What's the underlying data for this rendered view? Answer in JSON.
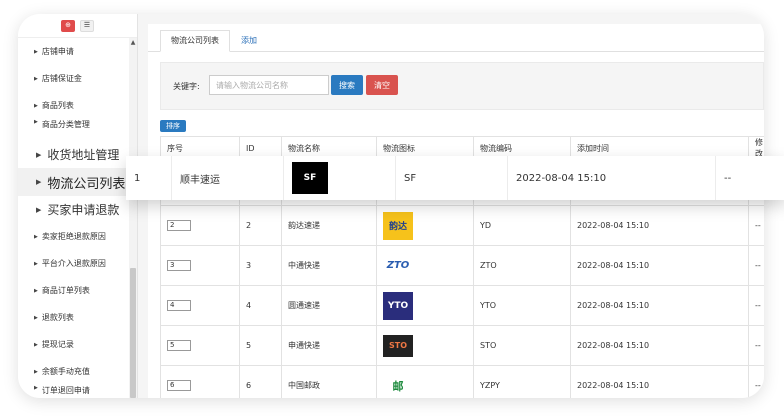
{
  "sidebar": {
    "top_buttons": [
      {
        "glyph": "⊕",
        "color": "#e04b4b"
      },
      {
        "glyph": "☰"
      }
    ],
    "items": [
      {
        "label": "店铺申请",
        "style": "normal"
      },
      {
        "label": "店铺保证金",
        "style": "normal"
      },
      {
        "label": "商品列表",
        "style": "normal"
      },
      {
        "label": "商品分类管理",
        "style": "partial"
      },
      {
        "label": "收货地址管理",
        "style": "big"
      },
      {
        "label": "物流公司列表",
        "style": "active"
      },
      {
        "label": "买家申请退款",
        "style": "big"
      },
      {
        "label": "卖家拒绝退款原因",
        "style": "normal"
      },
      {
        "label": "平台介入退款原因",
        "style": "normal"
      },
      {
        "label": "商品订单列表",
        "style": "normal"
      },
      {
        "label": "退款列表",
        "style": "normal"
      },
      {
        "label": "提现记录",
        "style": "normal"
      },
      {
        "label": "余额手动充值",
        "style": "normal"
      },
      {
        "label": "订单退回申请",
        "style": "partial"
      }
    ]
  },
  "tabs": [
    {
      "label": "物流公司列表",
      "active": true
    },
    {
      "label": "添加",
      "active": false
    }
  ],
  "search": {
    "label": "关键字:",
    "placeholder": "请输入物流公司名称",
    "search_label": "搜索",
    "clear_label": "清空"
  },
  "sort_button_label": "排序",
  "table": {
    "headers": [
      "序号",
      "ID",
      "物流名称",
      "物流图标",
      "物流编码",
      "添加时间",
      "修改"
    ],
    "rows": [
      {
        "sort": "1",
        "id": "1",
        "name": "顺丰速运",
        "logo": "sf",
        "logo_text": "SF",
        "code": "SF",
        "time": "2022-08-04 15:10",
        "modify": "--"
      },
      {
        "sort": "2",
        "id": "2",
        "name": "韵达速递",
        "logo": "yd",
        "logo_text": "韵达",
        "code": "YD",
        "time": "2022-08-04 15:10",
        "modify": "--"
      },
      {
        "sort": "3",
        "id": "3",
        "name": "中通快递",
        "logo": "zto",
        "logo_text": "ZTO",
        "code": "ZTO",
        "time": "2022-08-04 15:10",
        "modify": "--"
      },
      {
        "sort": "4",
        "id": "4",
        "name": "圆通速递",
        "logo": "yto",
        "logo_text": "YTO",
        "code": "YTO",
        "time": "2022-08-04 15:10",
        "modify": "--"
      },
      {
        "sort": "5",
        "id": "5",
        "name": "申通快递",
        "logo": "sto",
        "logo_text": "STO",
        "code": "STO",
        "time": "2022-08-04 15:10",
        "modify": "--"
      },
      {
        "sort": "6",
        "id": "6",
        "name": "中国邮政",
        "logo": "ems",
        "logo_text": "邮",
        "code": "YZPY",
        "time": "2022-08-04 15:10",
        "modify": "--"
      }
    ]
  }
}
